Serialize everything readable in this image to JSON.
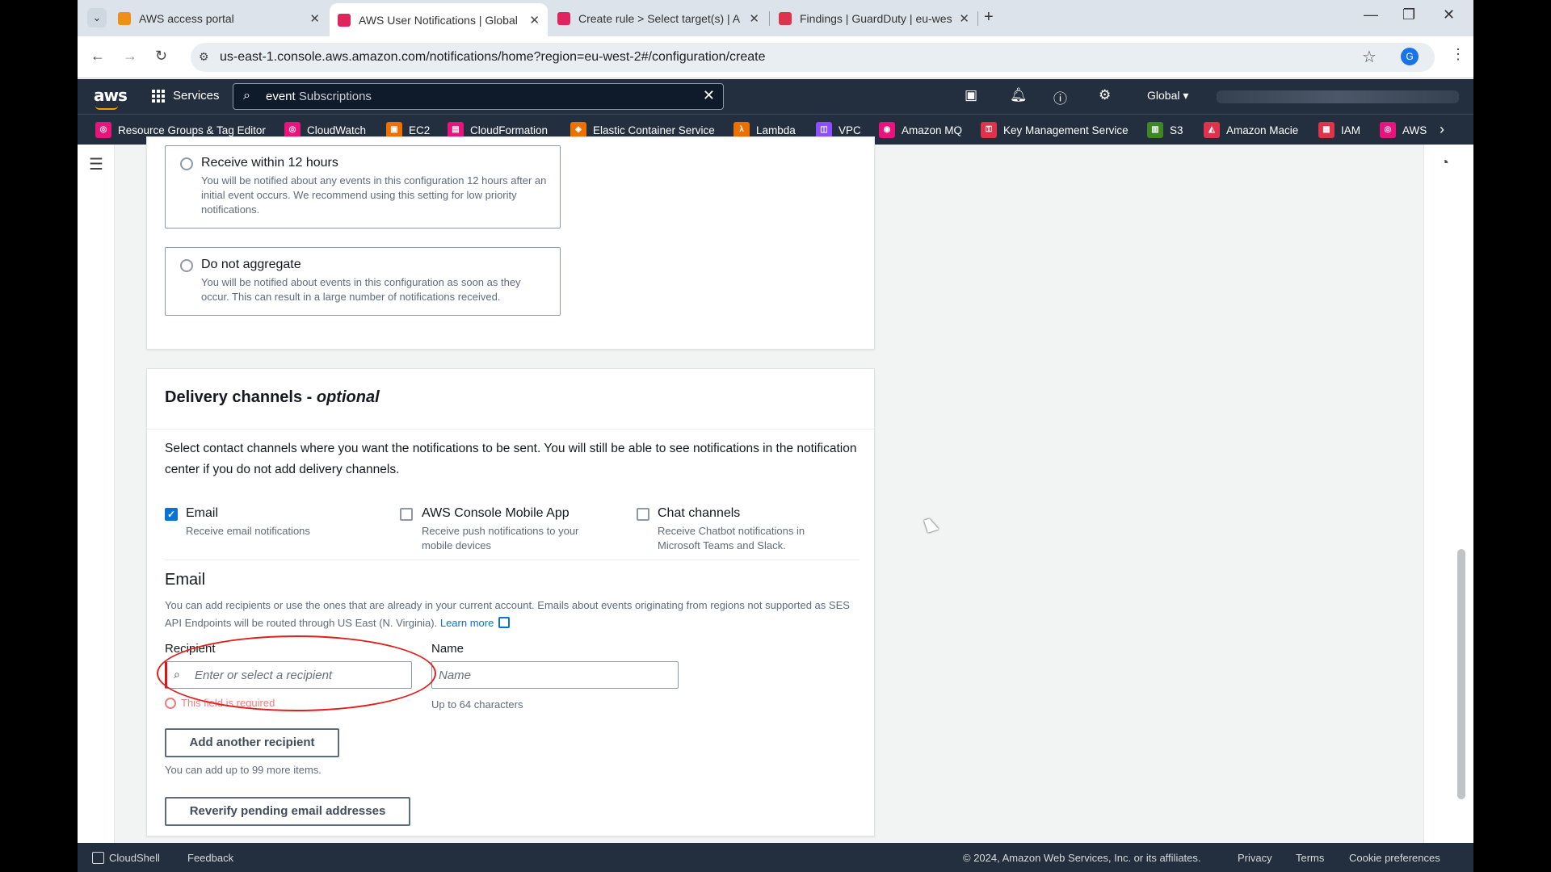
{
  "browser": {
    "tabs": [
      {
        "title": "AWS access portal",
        "fav_color": "#f08e1a"
      },
      {
        "title": "AWS User Notifications | Global",
        "fav_color": "#e0245e"
      },
      {
        "title": "Create rule > Select target(s) | A",
        "fav_color": "#e0245e"
      },
      {
        "title": "Findings | GuardDuty | eu-west",
        "fav_color": "#dd344c"
      }
    ],
    "url": "us-east-1.console.aws.amazon.com/notifications/home?region=eu-west-2#/configuration/create",
    "profile_initial": "G"
  },
  "aws_header": {
    "logo": "aws",
    "services_label": "Services",
    "search_query": "event",
    "search_suggestion": "Subscriptions",
    "region": "Global ▾"
  },
  "favorites": [
    {
      "label": "Resource Groups & Tag Editor",
      "color": "#e7157b"
    },
    {
      "label": "CloudWatch",
      "color": "#e7157b"
    },
    {
      "label": "EC2",
      "color": "#ed7100"
    },
    {
      "label": "CloudFormation",
      "color": "#e7157b"
    },
    {
      "label": "Elastic Container Service",
      "color": "#ed7100"
    },
    {
      "label": "Lambda",
      "color": "#ed7100"
    },
    {
      "label": "VPC",
      "color": "#8c4fff"
    },
    {
      "label": "Amazon MQ",
      "color": "#e7157b"
    },
    {
      "label": "Key Management Service",
      "color": "#dd344c"
    },
    {
      "label": "S3",
      "color": "#3f8624"
    },
    {
      "label": "Amazon Macie",
      "color": "#dd344c"
    },
    {
      "label": "IAM",
      "color": "#dd344c"
    },
    {
      "label": "AWS",
      "color": "#e7157b"
    }
  ],
  "aggregation": {
    "options": [
      {
        "title": "Receive within 12 hours",
        "desc": "You will be notified about any events in this configuration 12 hours after an initial event occurs. We recommend using this setting for low priority notifications."
      },
      {
        "title": "Do not aggregate",
        "desc": "You will be notified about events in this configuration as soon as they occur. This can result in a large number of notifications received."
      }
    ]
  },
  "delivery": {
    "title": "Delivery channels - ",
    "title_optional": "optional",
    "description": "Select contact channels where you want the notifications to be sent. You will still be able to see notifications in the notification center if you do not add delivery channels.",
    "channels": [
      {
        "label": "Email",
        "desc": "Receive email notifications",
        "checked": true
      },
      {
        "label": "AWS Console Mobile App",
        "desc": "Receive push notifications to your mobile devices",
        "checked": false
      },
      {
        "label": "Chat channels",
        "desc": "Receive Chatbot notifications in Microsoft Teams and Slack.",
        "checked": false
      }
    ],
    "email": {
      "heading": "Email",
      "info": "You can add recipients or use the ones that are already in your current account. Emails about events originating from regions not supported as SES API Endpoints will be routed through US East (N. Virginia).",
      "learn_more": "Learn more",
      "recipient_label": "Recipient",
      "recipient_placeholder": "Enter or select a recipient",
      "recipient_error": "This field is required",
      "name_label": "Name",
      "name_placeholder": "Name",
      "name_hint": "Up to 64 characters",
      "add_button": "Add another recipient",
      "add_hint": "You can add up to 99 more items.",
      "reverify_button": "Reverify pending email addresses"
    }
  },
  "footer": {
    "cloudshell": "CloudShell",
    "feedback": "Feedback",
    "copyright": "© 2024, Amazon Web Services, Inc. or its affiliates.",
    "privacy": "Privacy",
    "terms": "Terms",
    "cookie": "Cookie preferences"
  }
}
